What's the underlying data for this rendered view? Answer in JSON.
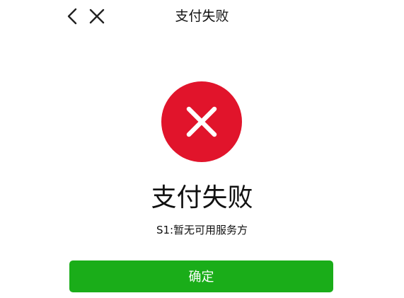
{
  "nav": {
    "title": "支付失败",
    "back_icon": "chevron-left-icon",
    "close_icon": "close-icon"
  },
  "result": {
    "status_icon": "error-x-circle-icon",
    "title": "支付失败",
    "reason": "S1:暂无可用服务方"
  },
  "actions": {
    "confirm_label": "确定"
  },
  "colors": {
    "error": "#e1142b",
    "primary_button": "#1aad19",
    "text": "#111111",
    "background": "#ffffff"
  }
}
